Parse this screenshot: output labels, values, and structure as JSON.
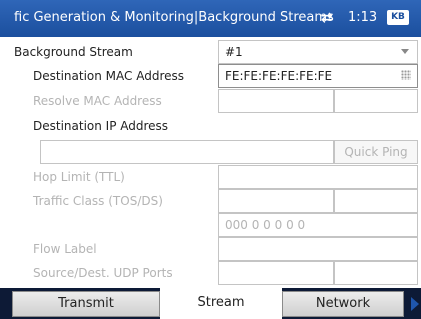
{
  "header": {
    "title": "fic Generation  & Monitoring|Background Streams",
    "time": "1:13",
    "connection_icon": "network-plug-icon",
    "keyboard_icon": "keyboard-icon",
    "keyboard_text": "KB"
  },
  "form": {
    "background_stream": {
      "label": "Background Stream",
      "value": "#1"
    },
    "dest_mac": {
      "label": "Destination MAC Address",
      "value": "FE:FE:FE:FE:FE:FE"
    },
    "resolve_mac": {
      "label": "Resolve MAC Address"
    },
    "dest_ip": {
      "label": "Destination IP Address"
    },
    "quick_ping": {
      "label": "Quick Ping"
    },
    "hop_limit": {
      "label": "Hop Limit (TTL)"
    },
    "traffic_class": {
      "label": "Traffic Class (TOS/DS)",
      "bits": "000 0 0 0 0 0"
    },
    "flow_label": {
      "label": "Flow Label"
    },
    "udp_ports": {
      "label": "Source/Dest. UDP Ports"
    }
  },
  "tabs": [
    {
      "label": "Transmit",
      "active": false
    },
    {
      "label": "Stream",
      "active": true
    },
    {
      "label": "Network",
      "active": false
    }
  ],
  "colors": {
    "title_bar": "#1b4f9e",
    "tab_strip": "#0d1a36",
    "disabled_text": "#b4b4b4"
  }
}
